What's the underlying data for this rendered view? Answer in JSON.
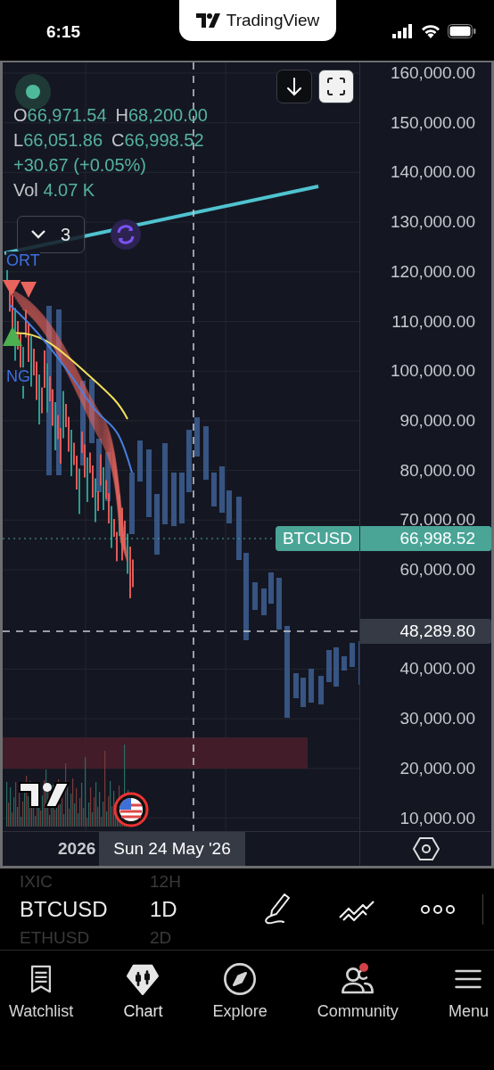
{
  "status_bar": {
    "time": "6:15",
    "app_pill": "TradingView"
  },
  "legend": {
    "ohlc": [
      {
        "label": "O",
        "value": "66,971.54"
      },
      {
        "label": "H",
        "value": "68,200.00"
      },
      {
        "label": "L",
        "value": "66,051.86"
      },
      {
        "label": "C",
        "value": "66,998.52"
      }
    ],
    "change": "+30.67 (+0.05%)",
    "volume": {
      "label": "Vol",
      "value": "4.07 K"
    }
  },
  "indicators_toggle": {
    "count": "3"
  },
  "chart_labels": [
    "ORT",
    "NG"
  ],
  "price_axis": [
    "160,000.00",
    "150,000.00",
    "140,000.00",
    "130,000.00",
    "120,000.00",
    "110,000.00",
    "100,000.00",
    "90,000.00",
    "80,000.00",
    "70,000.00",
    "60,000.00",
    "40,000.00",
    "30,000.00",
    "20,000.00",
    "10,000.00"
  ],
  "last_price": {
    "symbol": "BTCUSD",
    "price": "66,998.52"
  },
  "crosshair_price": "48,289.80",
  "time_axis": {
    "year": "2026",
    "crosshair_date": "Sun 24 May '26"
  },
  "symbol_picker": [
    {
      "symbol": "IXIC",
      "interval": "12H",
      "selected": false
    },
    {
      "symbol": "BTCUSD",
      "interval": "1D",
      "selected": true
    },
    {
      "symbol": "ETHUSD",
      "interval": "2D",
      "selected": false
    }
  ],
  "tabs": [
    {
      "label": "Watchlist",
      "selected": false,
      "badge": false
    },
    {
      "label": "Chart",
      "selected": true,
      "badge": false
    },
    {
      "label": "Explore",
      "selected": false,
      "badge": false
    },
    {
      "label": "Community",
      "selected": false,
      "badge": true
    },
    {
      "label": "Menu",
      "selected": false,
      "badge": false
    }
  ]
}
